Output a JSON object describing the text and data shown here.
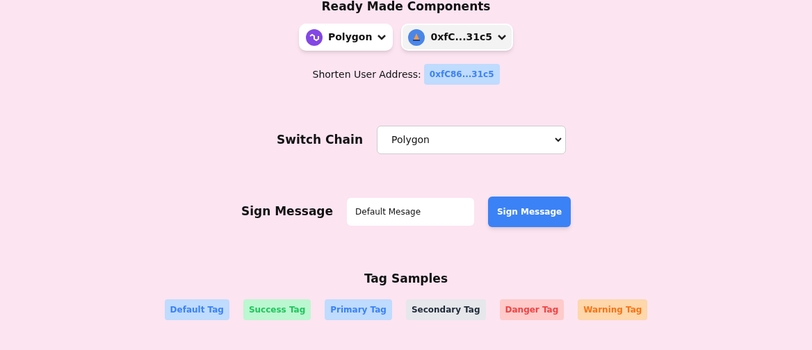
{
  "heading": "Ready Made Components",
  "chain_button": {
    "label": "Polygon"
  },
  "account_button": {
    "label": "0xfC...31c5"
  },
  "address": {
    "label": "Shorten User Address:",
    "value": "0xfC86...31c5"
  },
  "switch_chain": {
    "label": "Switch Chain",
    "value": "Polygon"
  },
  "sign": {
    "label": "Sign Message",
    "value": "Default Mesage",
    "button": "Sign Message"
  },
  "tags_title": "Tag Samples",
  "tags": [
    {
      "label": "Default Tag",
      "kind": "default"
    },
    {
      "label": "Success Tag",
      "kind": "success"
    },
    {
      "label": "Primary Tag",
      "kind": "primary"
    },
    {
      "label": "Secondary Tag",
      "kind": "secondary"
    },
    {
      "label": "Danger Tag",
      "kind": "danger"
    },
    {
      "label": "Warning Tag",
      "kind": "warning"
    }
  ]
}
